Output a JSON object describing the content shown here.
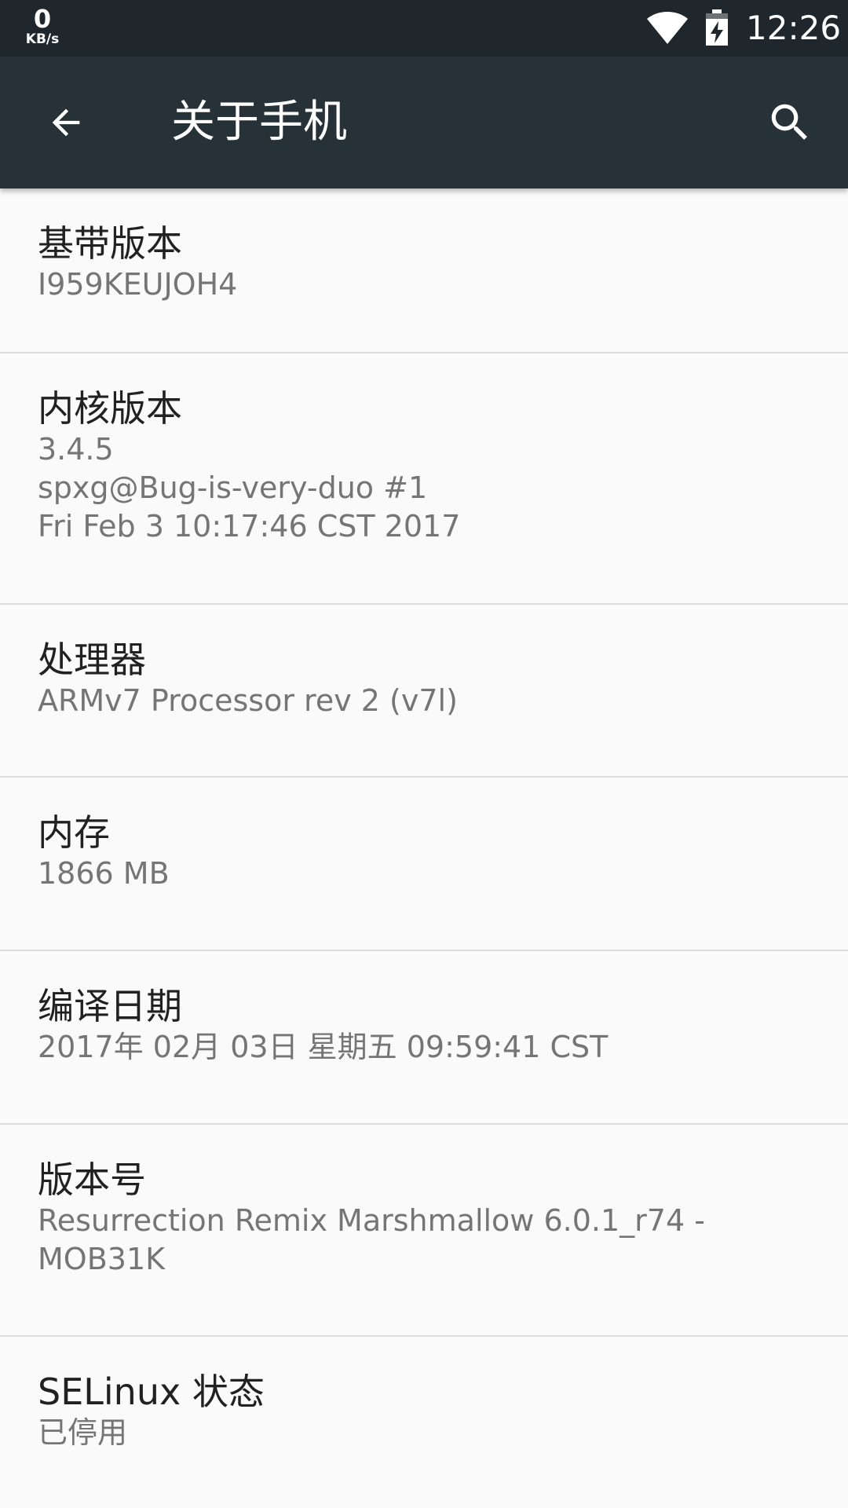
{
  "status_bar": {
    "net_speed_value": "0",
    "net_speed_unit": "KB/s",
    "time": "12:26",
    "icons": [
      "wifi-icon",
      "battery-charging-icon"
    ]
  },
  "app_bar": {
    "title": "关于手机",
    "icons": [
      "back-arrow-icon",
      "search-icon"
    ]
  },
  "items": [
    {
      "title": "基带版本",
      "summary": "I959KEUJOH4"
    },
    {
      "title": "内核版本",
      "summary": "3.4.5\nspxg@Bug-is-very-duo #1\nFri Feb 3 10:17:46 CST 2017"
    },
    {
      "title": "处理器",
      "summary": "ARMv7 Processor rev 2 (v7l)"
    },
    {
      "title": "内存",
      "summary": "1866 MB"
    },
    {
      "title": "编译日期",
      "summary": "2017年 02月 03日 星期五 09:59:41 CST"
    },
    {
      "title": "版本号",
      "summary": "Resurrection Remix Marshmallow 6.0.1_r74 -\nMOB31K"
    },
    {
      "title": "SELinux 状态",
      "summary": "已停用"
    }
  ],
  "colors": {
    "status_bar": "#1f272c",
    "app_bar": "#263238",
    "background": "#fafafa",
    "title_text": "#212121",
    "summary_text": "#757575",
    "divider": "#dcdcdc"
  }
}
